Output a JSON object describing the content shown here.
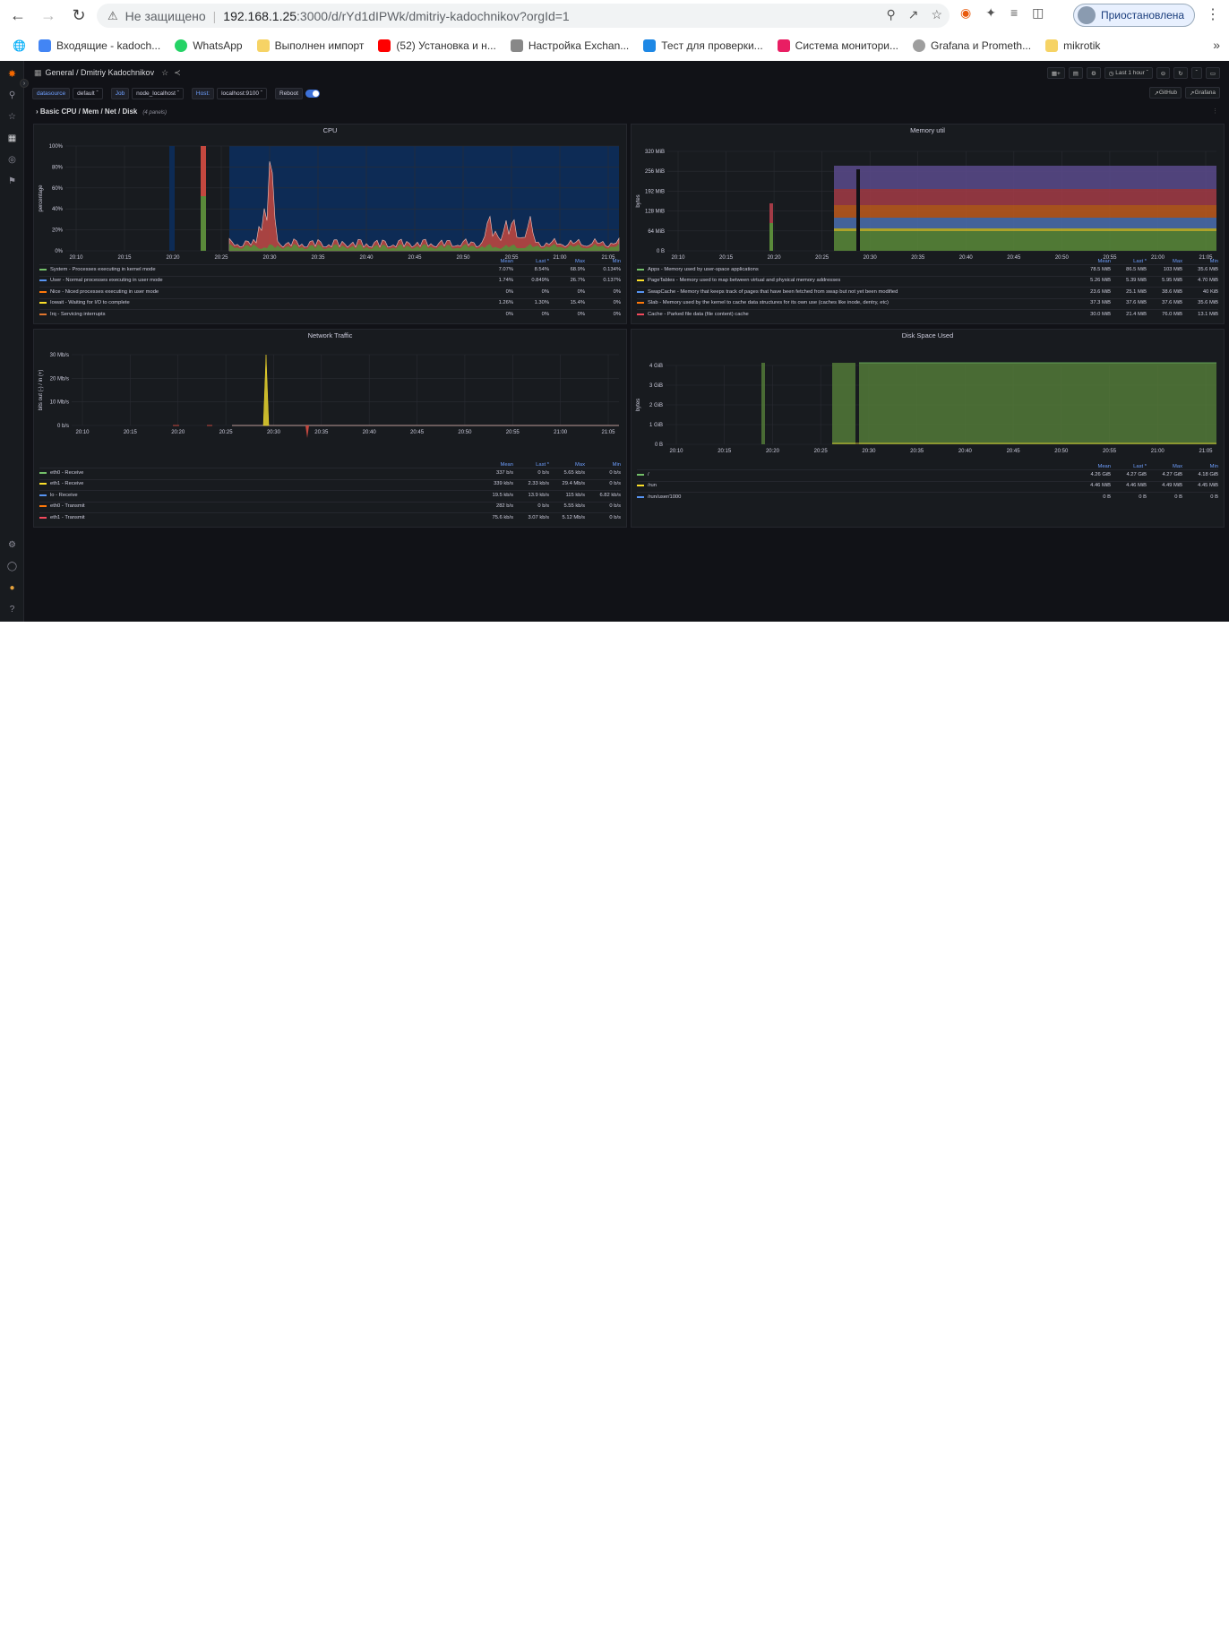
{
  "browser": {
    "insecure_label": "Не защищено",
    "url_host": "192.168.1.25",
    "url_path": ":3000/d/rYd1dIPWk/dmitriy-kadochnikov?orgId=1",
    "profile_label": "Приостановлена",
    "bookmarks": [
      {
        "label": "Входящие - kadoch...",
        "color": "#4285f4"
      },
      {
        "label": "WhatsApp",
        "color": "#25d366"
      },
      {
        "label": "Выполнен импорт",
        "color": "#f6d365"
      },
      {
        "label": "(52) Установка и н...",
        "color": "#ff0000"
      },
      {
        "label": "Настройка Exchan...",
        "color": "#888888"
      },
      {
        "label": "Тест для проверки...",
        "color": "#1e88e5"
      },
      {
        "label": "Система монитори...",
        "color": "#e91e63"
      },
      {
        "label": "Grafana и Prometh...",
        "color": "#9e9e9e"
      },
      {
        "label": "mikrotik",
        "color": "#f6d365"
      }
    ]
  },
  "grafana": {
    "breadcrumb": "General / Dmitriy Kadochnikov",
    "time_range": "Last 1 hour",
    "vars": {
      "datasource_label": "datasource",
      "datasource_value": "default",
      "job_label": "Job",
      "job_value": "node_localhost",
      "host_label": "Host:",
      "host_value": "localhost:9100",
      "reboot_label": "Reboot"
    },
    "links": {
      "github": "GitHub",
      "grafana": "Grafana"
    },
    "row": {
      "title": "Basic CPU / Mem / Net / Disk",
      "count": "(4 panels)"
    },
    "legend_headers": [
      "Mean",
      "Last *",
      "Max",
      "Min"
    ],
    "panels": {
      "cpu": {
        "title": "CPU",
        "ylabel": "percentage",
        "yticks": [
          "100%",
          "80%",
          "60%",
          "40%",
          "20%",
          "0%"
        ],
        "xticks": [
          "20:10",
          "20:15",
          "20:20",
          "20:25",
          "20:30",
          "20:35",
          "20:40",
          "20:45",
          "20:50",
          "20:55",
          "21:00",
          "21:05"
        ],
        "legend": [
          {
            "name": "System - Processes executing in kernel mode",
            "color": "#73bf69",
            "mean": "7.07%",
            "last": "8.54%",
            "max": "68.9%",
            "min": "0.134%"
          },
          {
            "name": "User - Normal processes executing in user mode",
            "color": "#5794f2",
            "mean": "1.74%",
            "last": "0.849%",
            "max": "26.7%",
            "min": "0.137%"
          },
          {
            "name": "Nice - Niced processes executing in user mode",
            "color": "#ff780a",
            "mean": "0%",
            "last": "0%",
            "max": "0%",
            "min": "0%"
          },
          {
            "name": "Iowait - Waiting for I/O to complete",
            "color": "#fade2a",
            "mean": "1.26%",
            "last": "1.30%",
            "max": "15.4%",
            "min": "0%"
          },
          {
            "name": "Irq - Servicing interrupts",
            "color": "#e0752d",
            "mean": "0%",
            "last": "0%",
            "max": "0%",
            "min": "0%"
          }
        ]
      },
      "memory": {
        "title": "Memory util",
        "ylabel": "bytes",
        "yticks": [
          "320 MiB",
          "256 MiB",
          "192 MiB",
          "128 MiB",
          "64 MiB",
          "0 B"
        ],
        "xticks": [
          "20:10",
          "20:15",
          "20:20",
          "20:25",
          "20:30",
          "20:35",
          "20:40",
          "20:45",
          "20:50",
          "20:55",
          "21:00",
          "21:05"
        ],
        "legend": [
          {
            "name": "Apps - Memory used by user-space applications",
            "color": "#73bf69",
            "mean": "78.5 MiB",
            "last": "86.5 MiB",
            "max": "103 MiB",
            "min": "35.6 MiB"
          },
          {
            "name": "PageTables - Memory used to map between virtual and physical memory addresses",
            "color": "#fade2a",
            "mean": "5.26 MiB",
            "last": "5.39 MiB",
            "max": "5.95 MiB",
            "min": "4.70 MiB"
          },
          {
            "name": "SwapCache - Memory that keeps track of pages that have been fetched from swap but not yet been modified",
            "color": "#5794f2",
            "mean": "23.6 MiB",
            "last": "25.1 MiB",
            "max": "38.6 MiB",
            "min": "40 KiB"
          },
          {
            "name": "Slab - Memory used by the kernel to cache data structures for its own use (caches like inode, dentry, etc)",
            "color": "#ff780a",
            "mean": "37.3 MiB",
            "last": "37.6 MiB",
            "max": "37.6 MiB",
            "min": "35.6 MiB"
          },
          {
            "name": "Cache - Parked file data (file content) cache",
            "color": "#f2495c",
            "mean": "30.0 MiB",
            "last": "21.4 MiB",
            "max": "76.0 MiB",
            "min": "13.1 MiB"
          }
        ]
      },
      "network": {
        "title": "Network Traffic",
        "ylabel": "bits out (-) / in (+)",
        "yticks": [
          "30 Mb/s",
          "20 Mb/s",
          "10 Mb/s",
          "0 b/s"
        ],
        "xticks": [
          "20:10",
          "20:15",
          "20:20",
          "20:25",
          "20:30",
          "20:35",
          "20:40",
          "20:45",
          "20:50",
          "20:55",
          "21:00",
          "21:05"
        ],
        "legend": [
          {
            "name": "eth0 - Receive",
            "color": "#73bf69",
            "mean": "337 b/s",
            "last": "0 b/s",
            "max": "5.65 kb/s",
            "min": "0 b/s"
          },
          {
            "name": "eth1 - Receive",
            "color": "#fade2a",
            "mean": "339 kb/s",
            "last": "2.33 kb/s",
            "max": "29.4 Mb/s",
            "min": "0 b/s"
          },
          {
            "name": "lo - Receive",
            "color": "#5794f2",
            "mean": "19.5 kb/s",
            "last": "13.9 kb/s",
            "max": "115 kb/s",
            "min": "6.82 kb/s"
          },
          {
            "name": "eth0 - Transmit",
            "color": "#ff780a",
            "mean": "282 b/s",
            "last": "0 b/s",
            "max": "5.55 kb/s",
            "min": "0 b/s"
          },
          {
            "name": "eth1 - Transmit",
            "color": "#f2495c",
            "mean": "75.6 kb/s",
            "last": "3.07 kb/s",
            "max": "5.12 Mb/s",
            "min": "0 b/s"
          }
        ]
      },
      "disk": {
        "title": "Disk Space Used",
        "ylabel": "bytes",
        "yticks": [
          "4 GiB",
          "3 GiB",
          "2 GiB",
          "1 GiB",
          "0 B"
        ],
        "xticks": [
          "20:10",
          "20:15",
          "20:20",
          "20:25",
          "20:30",
          "20:35",
          "20:40",
          "20:45",
          "20:50",
          "20:55",
          "21:00",
          "21:05"
        ],
        "legend": [
          {
            "name": "/",
            "color": "#73bf69",
            "mean": "4.26 GiB",
            "last": "4.27 GiB",
            "max": "4.27 GiB",
            "min": "4.18 GiB"
          },
          {
            "name": "/run",
            "color": "#fade2a",
            "mean": "4.46 MiB",
            "last": "4.46 MiB",
            "max": "4.49 MiB",
            "min": "4.45 MiB"
          },
          {
            "name": "/run/user/1000",
            "color": "#5794f2",
            "mean": "0 B",
            "last": "0 B",
            "max": "0 B",
            "min": "0 B"
          }
        ]
      }
    }
  }
}
